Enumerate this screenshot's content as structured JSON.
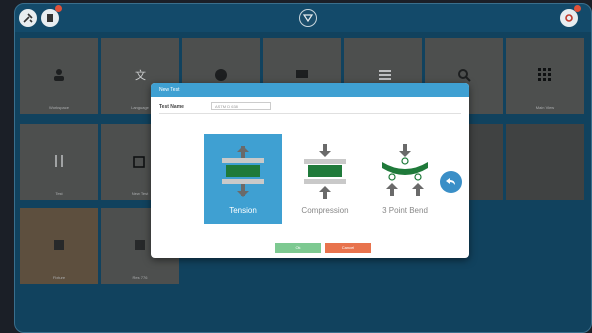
{
  "topbar": {
    "left_buttons": [
      "tools-icon",
      "clipboard-icon"
    ],
    "center_button": "filter-icon",
    "right_button": "settings-icon"
  },
  "tiles": [
    {
      "label": "Workspace",
      "icon": "user-icon"
    },
    {
      "label": "Language",
      "icon": "translate-icon"
    },
    {
      "label": "",
      "icon": "clock-icon"
    },
    {
      "label": "",
      "icon": "presentation-icon"
    },
    {
      "label": "",
      "icon": "list-icon"
    },
    {
      "label": "",
      "icon": "search-icon"
    },
    {
      "label": "Main View",
      "icon": "grid-icon"
    },
    {
      "label": "Test",
      "icon": "specimen-icon"
    },
    {
      "label": "New Test",
      "icon": "edit-icon"
    },
    {
      "label": "Fixture",
      "icon": "fixture-icon"
    },
    {
      "label": "Res 776",
      "icon": "fixture-icon"
    }
  ],
  "dialog": {
    "title": "New Test",
    "test_name_label": "Test Name",
    "test_name_value": "ASTM D 638",
    "options": [
      {
        "label": "Tension",
        "selected": true
      },
      {
        "label": "Compression",
        "selected": false
      },
      {
        "label": "3 Point Bend",
        "selected": false
      }
    ],
    "ok_label": "Ok",
    "cancel_label": "Cancel"
  },
  "colors": {
    "accent": "#3fa0d2",
    "green": "#1f7a3a",
    "ok": "#7dc991",
    "cancel": "#e8734d",
    "background": "#134a6a"
  }
}
